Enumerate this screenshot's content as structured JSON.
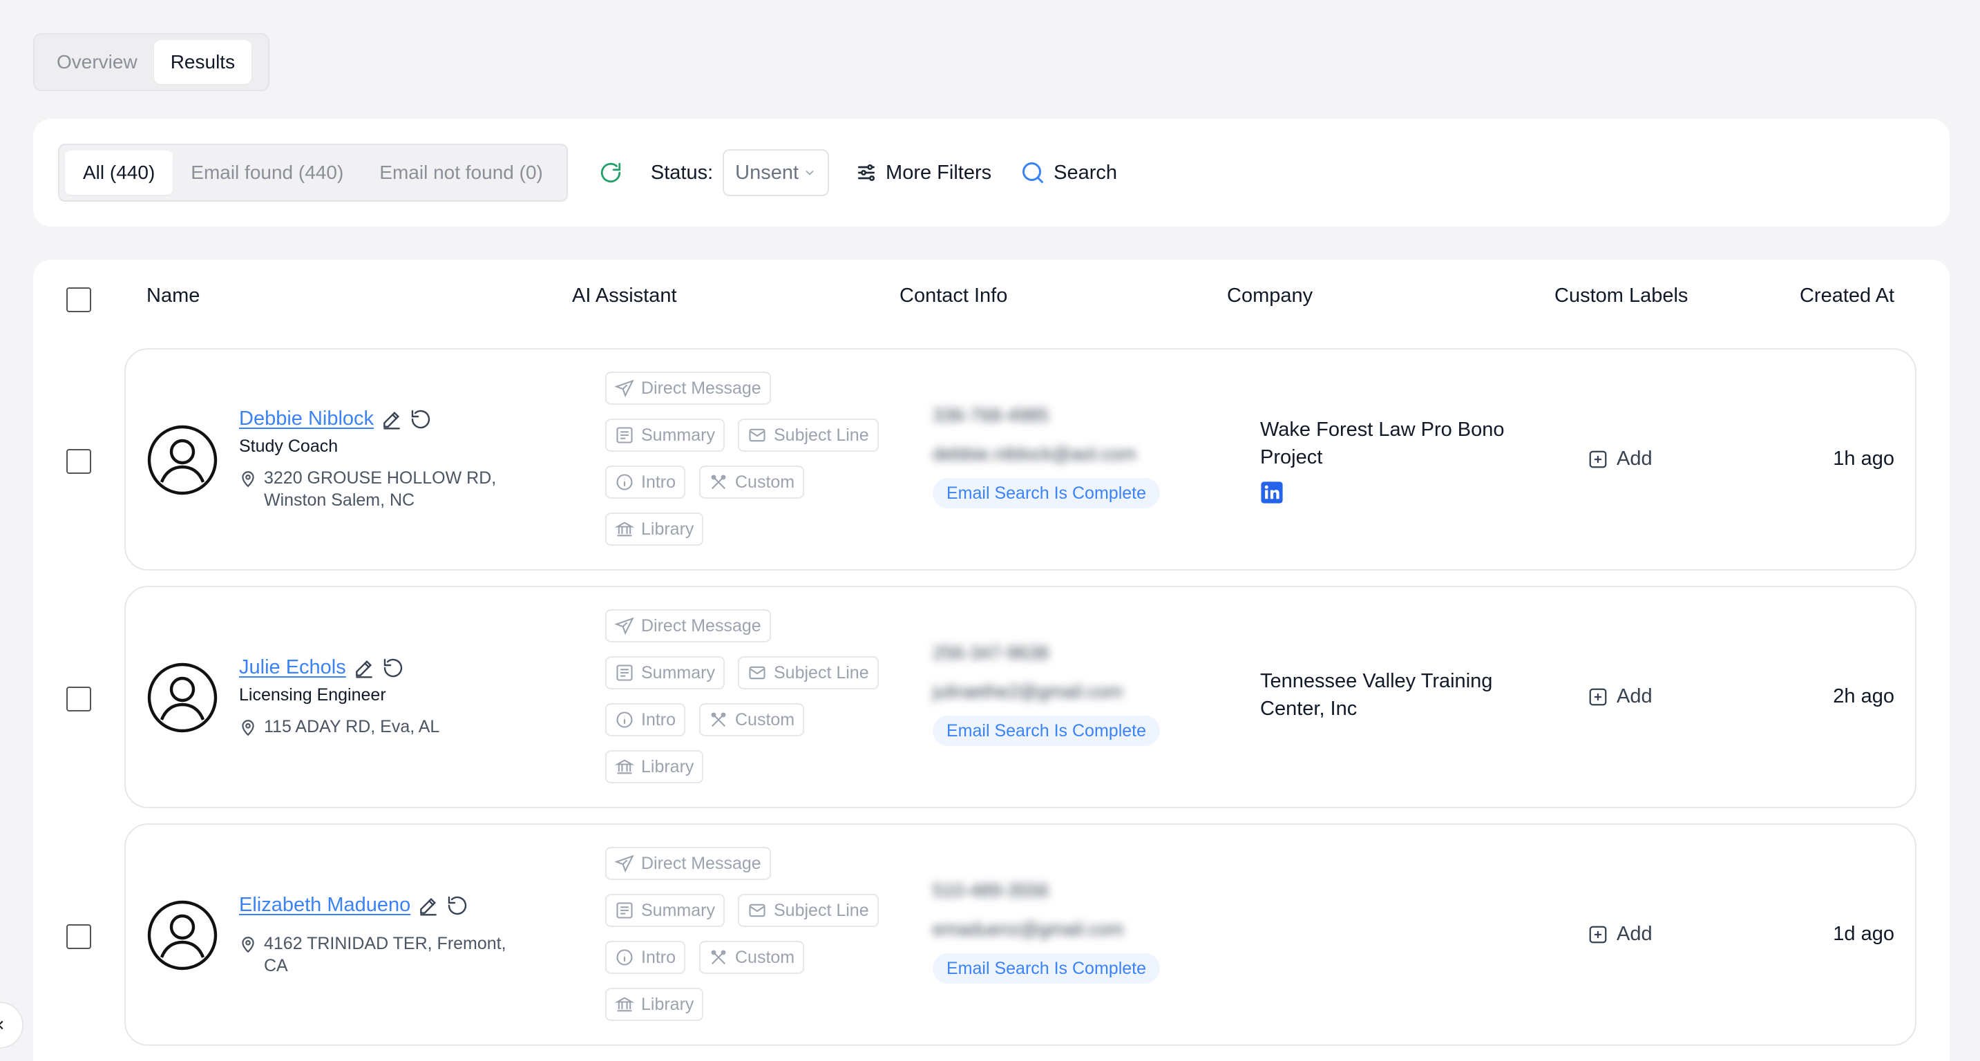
{
  "page_tabs": [
    {
      "label": "Overview",
      "active": false
    },
    {
      "label": "Results",
      "active": true
    }
  ],
  "filters": {
    "segments": [
      {
        "label": "All (440)",
        "active": true
      },
      {
        "label": "Email found (440)",
        "active": false
      },
      {
        "label": "Email not found (0)",
        "active": false
      }
    ],
    "status_label": "Status:",
    "status_value": "Unsent",
    "more_filters_label": "More Filters",
    "search_label": "Search"
  },
  "table": {
    "headers": {
      "name": "Name",
      "ai_assistant": "AI Assistant",
      "contact_info": "Contact Info",
      "company": "Company",
      "custom_labels": "Custom Labels",
      "created_at": "Created At"
    },
    "ai_actions": {
      "direct_message": "Direct Message",
      "summary": "Summary",
      "subject_line": "Subject Line",
      "intro": "Intro",
      "custom": "Custom",
      "library": "Library"
    },
    "email_status": "Email Search Is Complete",
    "add_label": "Add",
    "rows": [
      {
        "name": "Debbie Niblock",
        "title": "Study Coach",
        "location": "3220 GROUSE HOLLOW RD, Winston Salem, NC",
        "phone": "336-768-4985",
        "email": "debbie.niblock@aol.com",
        "company": "Wake Forest Law Pro Bono Project",
        "has_linkedin": true,
        "created": "1h ago"
      },
      {
        "name": "Julie Echols",
        "title": "Licensing Engineer",
        "location": "115 ADAY RD, Eva, AL",
        "phone": "256-347-9638",
        "email": "juliraethe2@gmail.com",
        "company": "Tennessee Valley Training Center, Inc",
        "has_linkedin": false,
        "created": "2h ago"
      },
      {
        "name": "Elizabeth Madueno",
        "title": "",
        "location": "4162 TRINIDAD TER, Fremont, CA",
        "phone": "510-489-3556",
        "email": "emaduenz@gmail.com",
        "company": "",
        "has_linkedin": false,
        "created": "1d ago"
      }
    ]
  },
  "colors": {
    "accent": "#3b82f6",
    "refresh": "#22a06b",
    "linkedin": "#2563eb"
  }
}
